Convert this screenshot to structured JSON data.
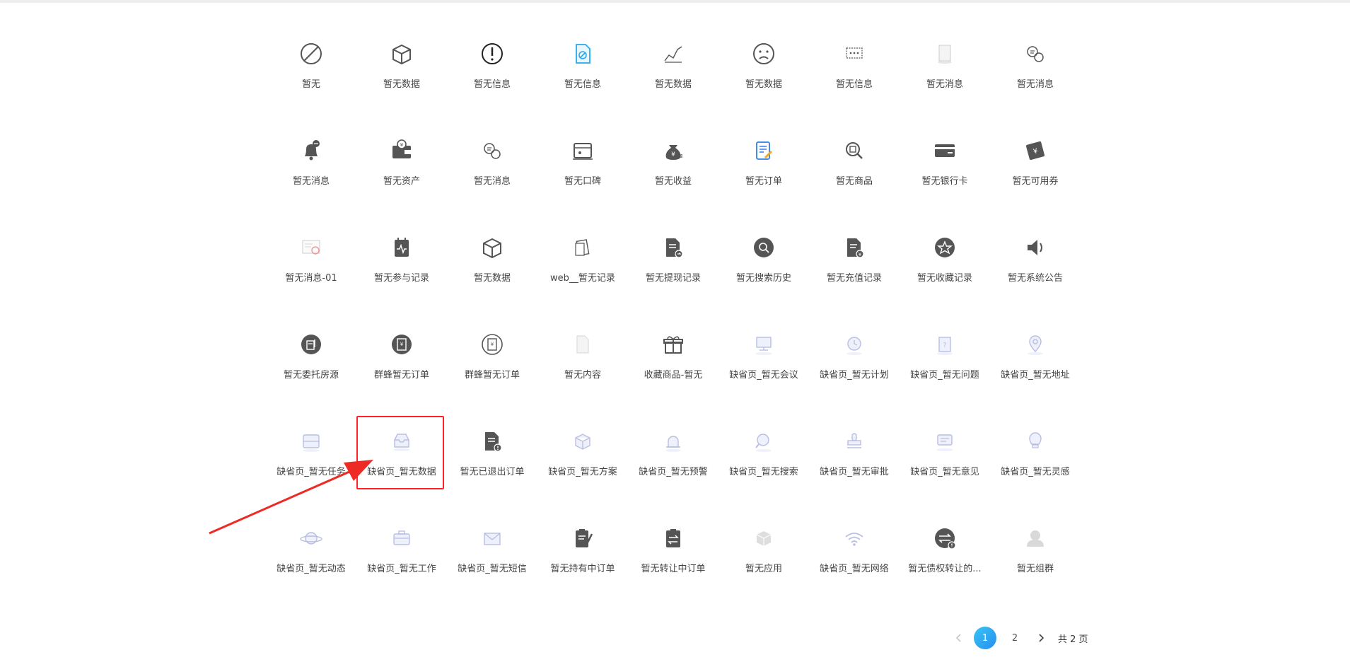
{
  "items": [
    {
      "label": "暂无",
      "icon": "prohibited-icon"
    },
    {
      "label": "暂无数据",
      "icon": "box-icon"
    },
    {
      "label": "暂无信息",
      "icon": "exclamation-circle-icon"
    },
    {
      "label": "暂无信息",
      "icon": "file-forbidden-icon"
    },
    {
      "label": "暂无数据",
      "icon": "chart-line-icon"
    },
    {
      "label": "暂无数据",
      "icon": "sad-face-icon"
    },
    {
      "label": "暂无信息",
      "icon": "message-dots-icon"
    },
    {
      "label": "暂无消息",
      "icon": "blank-page-icon"
    },
    {
      "label": "暂无消息",
      "icon": "chat-bubbles-icon"
    },
    {
      "label": "暂无消息",
      "icon": "bell-icon"
    },
    {
      "label": "暂无资产",
      "icon": "wallet-icon"
    },
    {
      "label": "暂无消息",
      "icon": "chat-bubbles-icon"
    },
    {
      "label": "暂无口碑",
      "icon": "storefront-icon"
    },
    {
      "label": "暂无收益",
      "icon": "money-bag-icon"
    },
    {
      "label": "暂无订单",
      "icon": "order-edit-icon"
    },
    {
      "label": "暂无商品",
      "icon": "product-search-icon"
    },
    {
      "label": "暂无银行卡",
      "icon": "credit-card-icon"
    },
    {
      "label": "暂无可用券",
      "icon": "coupon-icon"
    },
    {
      "label": "暂无消息-01",
      "icon": "certificate-icon"
    },
    {
      "label": "暂无参与记录",
      "icon": "calendar-activity-icon"
    },
    {
      "label": "暂无数据",
      "icon": "box-icon"
    },
    {
      "label": "web__暂无记录",
      "icon": "cards-icon"
    },
    {
      "label": "暂无提现记录",
      "icon": "document-arrow-icon"
    },
    {
      "label": "暂无搜索历史",
      "icon": "search-history-icon"
    },
    {
      "label": "暂无充值记录",
      "icon": "document-yen-icon"
    },
    {
      "label": "暂无收藏记录",
      "icon": "favorite-icon"
    },
    {
      "label": "暂无系统公告",
      "icon": "speaker-icon"
    },
    {
      "label": "暂无委托房源",
      "icon": "property-icon"
    },
    {
      "label": "群蜂暂无订单",
      "icon": "yen-order-icon"
    },
    {
      "label": "群蜂暂无订单",
      "icon": "yen-order-outline-icon"
    },
    {
      "label": "暂无内容",
      "icon": "empty-file-icon"
    },
    {
      "label": "收藏商品-暂无",
      "icon": "gift-icon"
    },
    {
      "label": "缺省页_暂无会议",
      "icon": "meeting-icon"
    },
    {
      "label": "缺省页_暂无计划",
      "icon": "plan-clock-icon"
    },
    {
      "label": "缺省页_暂无问题",
      "icon": "question-icon"
    },
    {
      "label": "缺省页_暂无地址",
      "icon": "location-icon"
    },
    {
      "label": "缺省页_暂无任务",
      "icon": "task-icon"
    },
    {
      "label": "缺省页_暂无数据",
      "icon": "inbox-icon"
    },
    {
      "label": "暂无已退出订单",
      "icon": "document-alert-icon"
    },
    {
      "label": "缺省页_暂无方案",
      "icon": "cube-plan-icon"
    },
    {
      "label": "缺省页_暂无预警",
      "icon": "alarm-icon"
    },
    {
      "label": "缺省页_暂无搜索",
      "icon": "search-empty-icon"
    },
    {
      "label": "缺省页_暂无审批",
      "icon": "stamp-icon"
    },
    {
      "label": "缺省页_暂无意见",
      "icon": "feedback-icon"
    },
    {
      "label": "缺省页_暂无灵感",
      "icon": "lightbulb-icon"
    },
    {
      "label": "缺省页_暂无动态",
      "icon": "planet-icon"
    },
    {
      "label": "缺省页_暂无工作",
      "icon": "briefcase-icon"
    },
    {
      "label": "缺省页_暂无短信",
      "icon": "envelope-icon"
    },
    {
      "label": "暂无持有中订单",
      "icon": "clipboard-edit-icon"
    },
    {
      "label": "暂无转让中订单",
      "icon": "clipboard-transfer-icon"
    },
    {
      "label": "暂无应用",
      "icon": "app-cube-icon"
    },
    {
      "label": "缺省页_暂无网络",
      "icon": "wifi-icon"
    },
    {
      "label": "暂无债权转让的...",
      "icon": "transfer-alert-icon"
    },
    {
      "label": "暂无组群",
      "icon": "user-icon"
    }
  ],
  "pagination": {
    "prev_icon": "chevron-left-icon",
    "next_icon": "chevron-right-icon",
    "pages": [
      "1",
      "2"
    ],
    "current": "1",
    "total_text": "共 2 页"
  },
  "annotation": {
    "highlight_color": "#ff2222",
    "highlighted_label": "缺省页_暂无数据"
  },
  "colors": {
    "dark_icon": "#555555",
    "light_icon": "#b8bfe0",
    "accent_blue": "#2a8cf0"
  }
}
